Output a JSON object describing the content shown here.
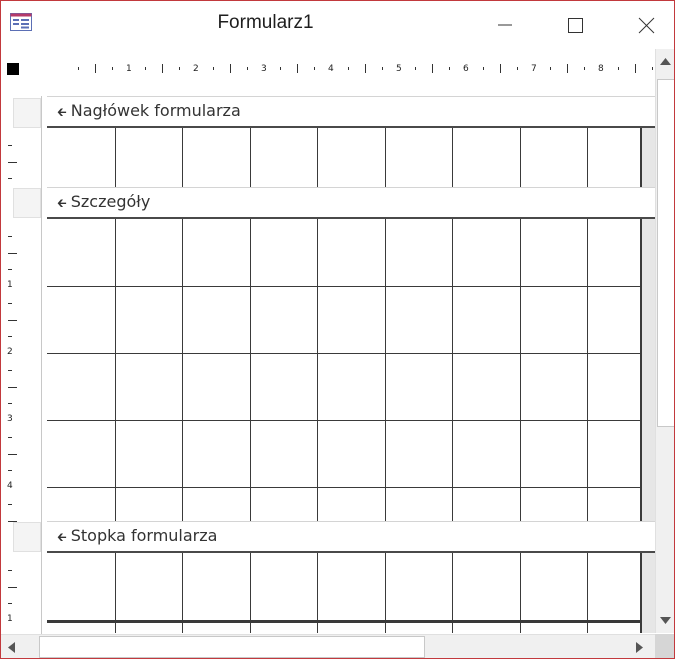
{
  "window": {
    "title": "Formularz1",
    "minimize_icon": "minimize-icon",
    "maximize_icon": "maximize-icon",
    "close_icon": "close-icon"
  },
  "ruler": {
    "horizontal_labels": [
      "1",
      "2",
      "3",
      "4",
      "5",
      "6",
      "7",
      "8"
    ],
    "vertical_labels": [
      "1",
      "2",
      "3",
      "4",
      "1"
    ]
  },
  "sections": {
    "header": {
      "label": "Nagłówek formularza"
    },
    "detail": {
      "label": "Szczegóły"
    },
    "footer": {
      "label": "Stopka formularza"
    }
  },
  "colors": {
    "window_border": "#c2393d",
    "grid_line": "#3a3a3a",
    "section_rule": "#4a4a4a"
  }
}
